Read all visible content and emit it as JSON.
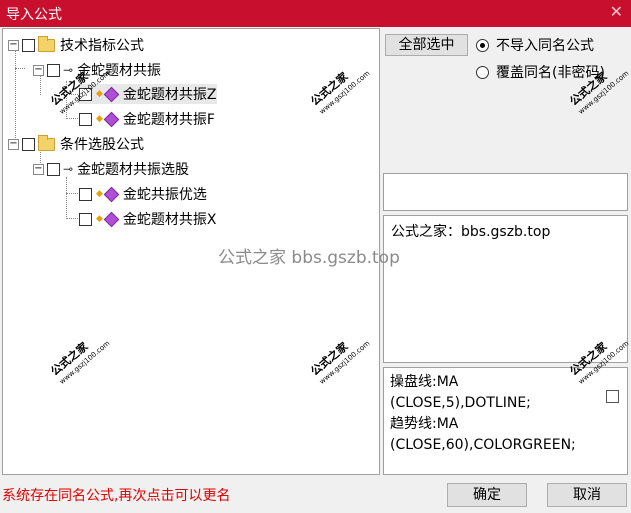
{
  "window": {
    "title": "导入公式",
    "close_glyph": "✕"
  },
  "tree": {
    "group1": {
      "label": "技术指标公式",
      "expander": "−"
    },
    "group1_formula": {
      "label": "金蛇题材共振",
      "expander": "−"
    },
    "group1_items": [
      "金蛇题材共振Z",
      "金蛇题材共振F"
    ],
    "group2": {
      "label": "条件选股公式",
      "expander": "−"
    },
    "group2_formula": {
      "label": "金蛇题材共振选股",
      "expander": "−"
    },
    "group2_items": [
      "金蛇共振优选",
      "金蛇题材共振X"
    ]
  },
  "buttons": {
    "select_all": "全部选中",
    "ok": "确定",
    "cancel": "取消"
  },
  "options": {
    "no_import_same": {
      "label": "不导入同名公式",
      "checked": true
    },
    "overwrite_same": {
      "label": "覆盖同名(非密码)",
      "checked": false
    }
  },
  "description": "公式之家：bbs.gszb.top",
  "source_lines": [
    "操盘线:MA",
    "(CLOSE,5),DOTLINE;",
    "趋势线:MA",
    "(CLOSE,60),COLORGREEN;"
  ],
  "status_message": "系统存在同名公式,再次点击可以更名",
  "watermark": {
    "center_text": "公式之家 bbs.gszb.top",
    "badge_text": "公式之家",
    "badge_url": "www.gszj100.com"
  }
}
